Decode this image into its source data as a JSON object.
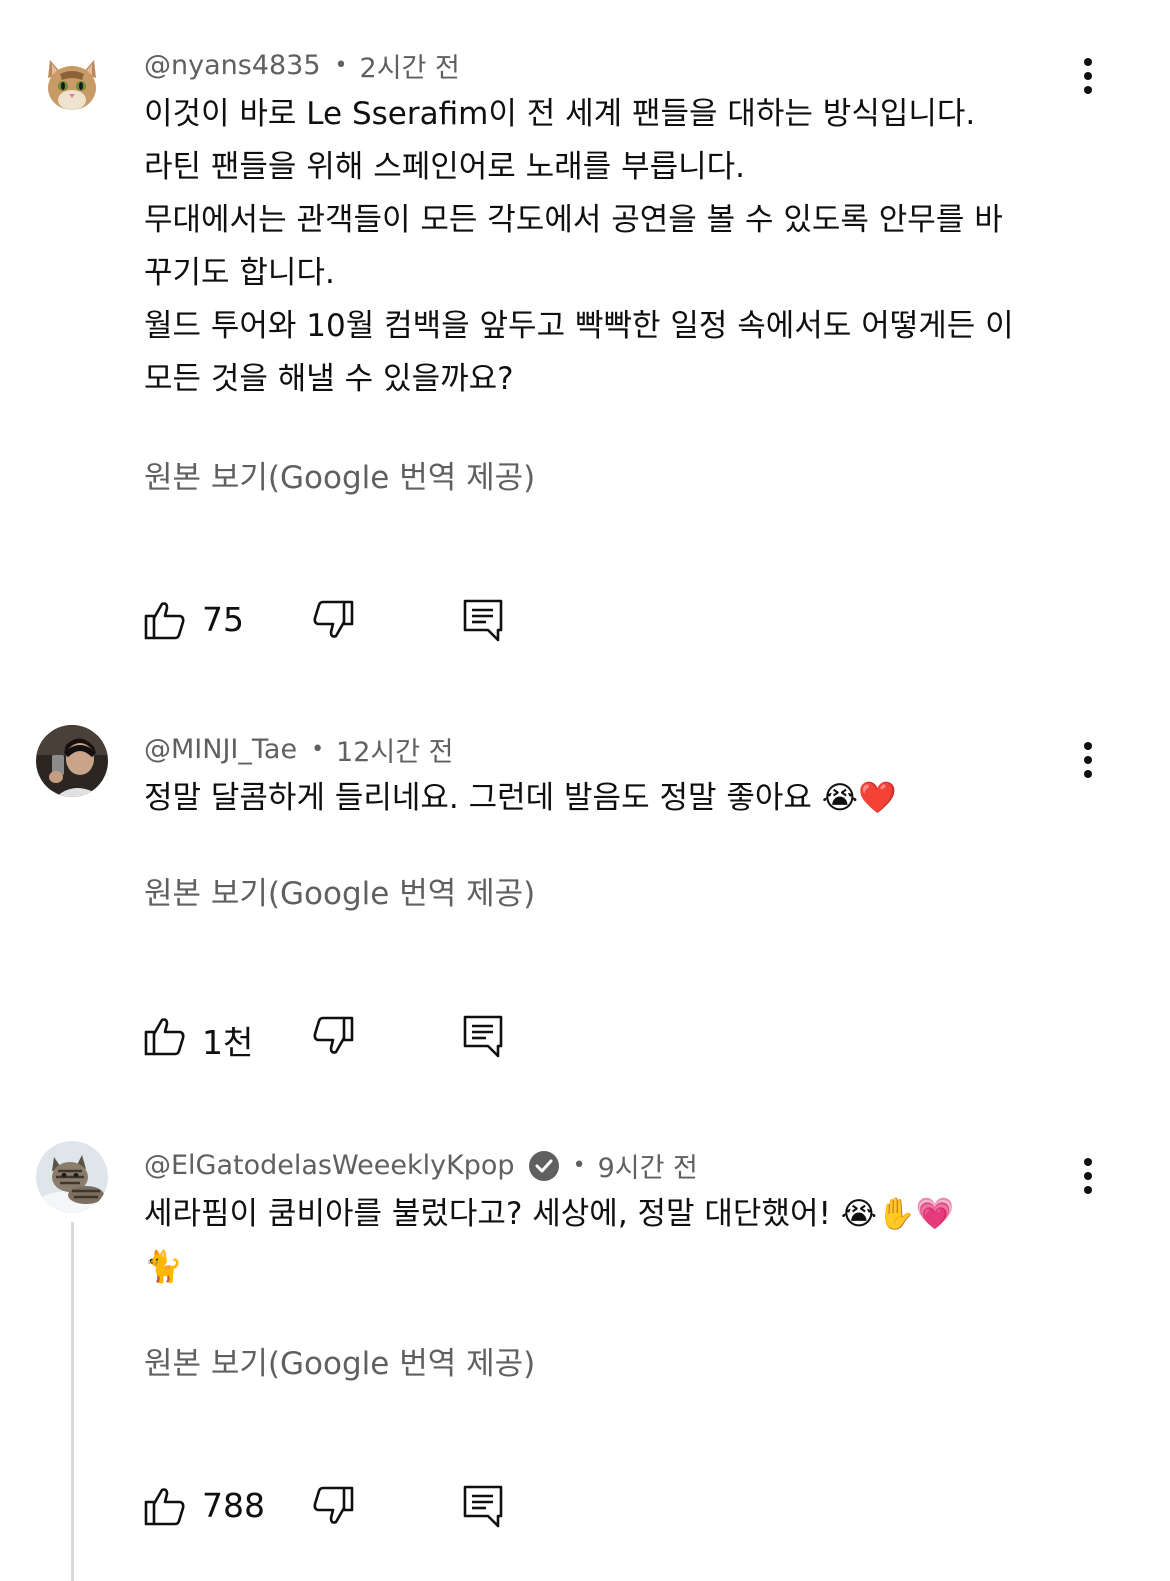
{
  "comments": [
    {
      "author": "@nyans4835",
      "separator": "•",
      "time": "2시간 전",
      "avatar_icon": "cat-face-avatar",
      "text": "이것이 바로 Le Sserafim이 전 세계 팬들을 대하는 방식입니다.\n라틴 팬들을 위해 스페인어로 노래를 부릅니다.\n무대에서는 관객들이 모든 각도에서 공연을 볼 수 있도록 안무를 바\n꾸기도 합니다.\n월드 투어와 10월 컴백을 앞두고 빡빡한 일정 속에서도 어떻게든 이\n모든 것을 해낼 수 있을까요?",
      "translate_label": "원본 보기(Google 번역 제공)",
      "likes": "75"
    },
    {
      "author": "@MINJI_Tae",
      "separator": "•",
      "time": "12시간 전",
      "avatar_icon": "person-selfie-avatar",
      "text": "정말 달콤하게 들리네요. 그런데 발음도 정말 좋아요 😭❤️",
      "translate_label": "원본 보기(Google 번역 제공)",
      "likes": "1천"
    },
    {
      "author": "@ElGatodelasWeeeklyKpop",
      "verified": true,
      "separator": "•",
      "time": "9시간 전",
      "avatar_icon": "tabby-cat-avatar",
      "text": "세라핌이 쿰비아를 불렀다고? 세상에, 정말 대단했어! 😭✋💗\n🐈",
      "translate_label": "원본 보기(Google 번역 제공)",
      "likes": "788"
    }
  ],
  "icons": {
    "like": "thumbs-up-icon",
    "dislike": "thumbs-down-icon",
    "reply": "reply-icon",
    "more": "more-vertical-icon",
    "verified": "verified-check-icon"
  },
  "colors": {
    "primary_text": "#0f0f0f",
    "secondary_text": "#606060",
    "background": "#ffffff"
  }
}
